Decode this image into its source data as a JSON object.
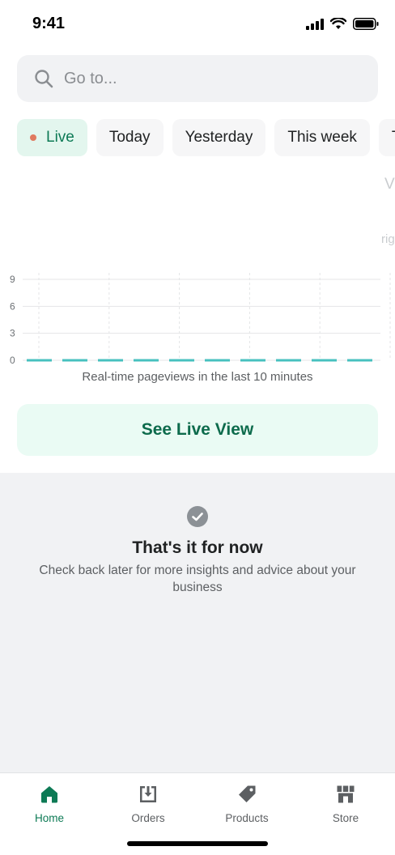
{
  "status_bar": {
    "time": "9:41"
  },
  "search": {
    "placeholder": "Go to..."
  },
  "chips": [
    {
      "label": "Live",
      "active": true
    },
    {
      "label": "Today",
      "active": false
    },
    {
      "label": "Yesterday",
      "active": false
    },
    {
      "label": "This week",
      "active": false
    },
    {
      "label": "T",
      "active": false
    }
  ],
  "ghost": {
    "a": "V",
    "b": "rig"
  },
  "chart_data": {
    "type": "line",
    "y_ticks": [
      "0",
      "3",
      "6",
      "9"
    ],
    "ylim": [
      0,
      9
    ],
    "x": [
      1,
      2,
      3,
      4,
      5,
      6,
      7,
      8,
      9,
      10
    ],
    "series": [
      {
        "values": [
          0,
          0,
          0,
          0,
          0,
          0,
          0,
          0,
          0,
          0
        ],
        "color": "#47c1bf",
        "dashed": true
      }
    ],
    "grid": true
  },
  "chart_caption": "Real-time pageviews in the last 10 minutes",
  "live_view_button": "See Live View",
  "empty_state": {
    "title": "That's it for now",
    "description": "Check back later for more insights and advice about your business"
  },
  "tabs": [
    {
      "label": "Home",
      "icon": "home-icon",
      "active": true
    },
    {
      "label": "Orders",
      "icon": "orders-icon",
      "active": false
    },
    {
      "label": "Products",
      "icon": "tag-icon",
      "active": false
    },
    {
      "label": "Store",
      "icon": "store-icon",
      "active": false
    }
  ],
  "colors": {
    "accent": "#0d7a55",
    "live_dot": "#e07a5f",
    "chart_line": "#47c1bf"
  }
}
